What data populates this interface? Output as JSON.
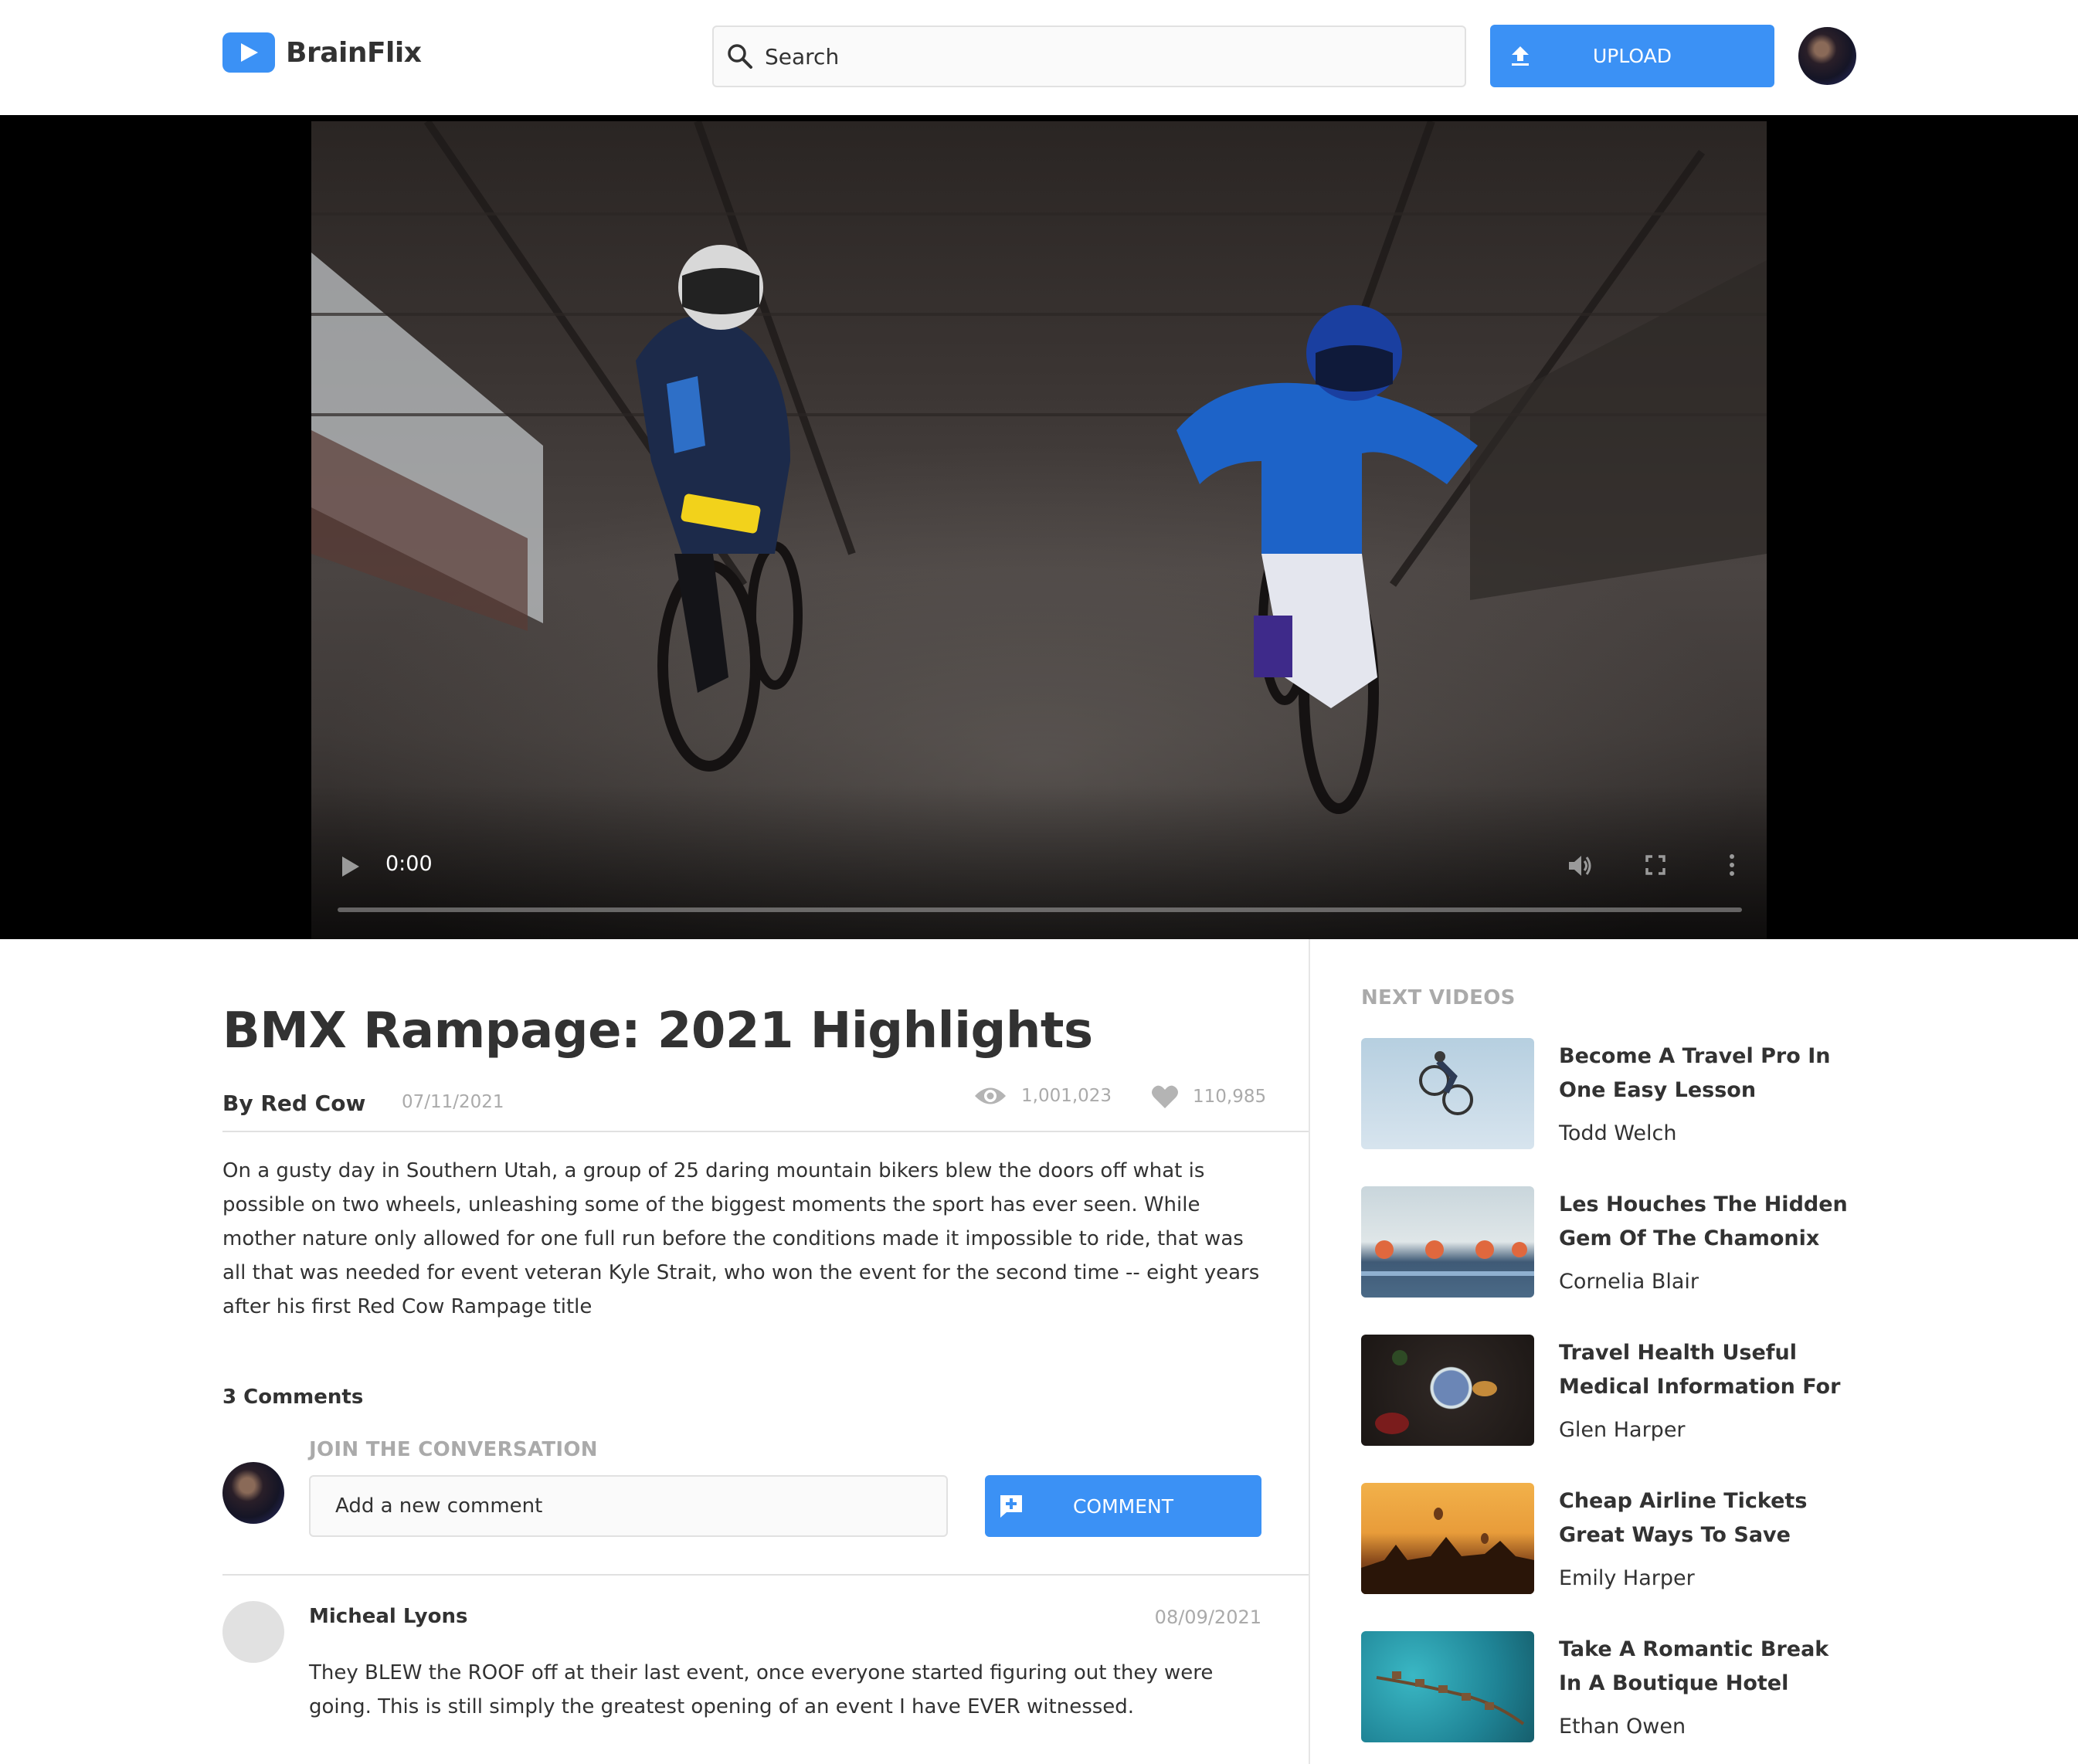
{
  "header": {
    "app_name": "BrainFlix",
    "search_placeholder": "Search",
    "upload_label": "UPLOAD"
  },
  "video": {
    "time": "0:00",
    "progress": 0
  },
  "main": {
    "title": "BMX Rampage: 2021 Highlights",
    "author": "By Red Cow",
    "date": "07/11/2021",
    "views": "1,001,023",
    "likes": "110,985",
    "description": "On a gusty day in Southern Utah, a group of 25 daring mountain bikers blew the doors off what is possible on two wheels, unleashing some of the biggest moments the sport has ever seen. While mother nature only allowed for one full run before the conditions made it impossible to ride, that was all that was needed for event veteran Kyle Strait, who won the event for the second time -- eight years after his first Red Cow Rampage title"
  },
  "comments": {
    "count_label": "3 Comments",
    "join_label": "JOIN THE CONVERSATION",
    "input_placeholder": "Add a new comment",
    "button_label": "COMMENT",
    "items": [
      {
        "name": "Micheal Lyons",
        "date": "08/09/2021",
        "text": "They BLEW the ROOF off at their last event, once everyone started figuring out they were going. This is still simply the greatest opening of an event I have EVER witnessed."
      }
    ]
  },
  "sidebar": {
    "heading": "NEXT VIDEOS",
    "videos": [
      {
        "title": "Become A Travel Pro In One Easy Lesson",
        "author": "Todd Welch"
      },
      {
        "title": "Les Houches The Hidden Gem Of The Chamonix",
        "author": "Cornelia Blair"
      },
      {
        "title": "Travel Health Useful Medical Information For",
        "author": "Glen Harper"
      },
      {
        "title": "Cheap Airline Tickets Great Ways To Save",
        "author": "Emily Harper"
      },
      {
        "title": "Take A Romantic Break In A Boutique Hotel",
        "author": "Ethan Owen"
      }
    ]
  },
  "colors": {
    "accent": "#3b91f5",
    "text": "#323232",
    "muted": "#aaaaaa",
    "border": "#e1e1e1"
  }
}
